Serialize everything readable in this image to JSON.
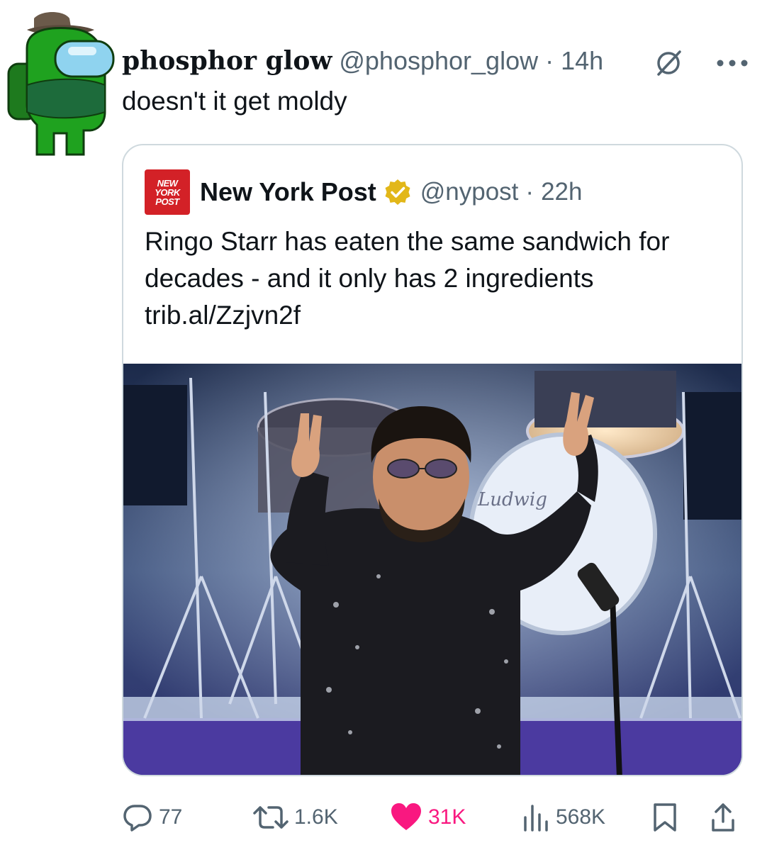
{
  "tweet": {
    "display_name": "phosphor glow",
    "handle": "@phosphor_glow",
    "separator": "·",
    "time": "14h",
    "text": "doesn't it get moldy",
    "avatar_icon": "green-crewmate-avatar-icon"
  },
  "quoted_tweet": {
    "display_name": "New York Post",
    "handle": "@nypost",
    "separator": "·",
    "time": "22h",
    "logo_lines": [
      "NEW",
      "YORK",
      "POST"
    ],
    "text_line_1": "Ringo Starr has eaten the same sandwich for",
    "text_line_2": "decades - and it only has 2 ingredients",
    "link": "trib.al/Zzjvn2f",
    "image_drum_text": "Ludwig",
    "verified_color": "#e2b719"
  },
  "actions": {
    "replies": "77",
    "reposts": "1.6K",
    "likes": "31K",
    "views": "568K"
  },
  "colors": {
    "text_primary": "#0f1419",
    "text_secondary": "#536471",
    "like_pink": "#f91880",
    "border": "#cfd9de",
    "nypost_red": "#d32127"
  }
}
